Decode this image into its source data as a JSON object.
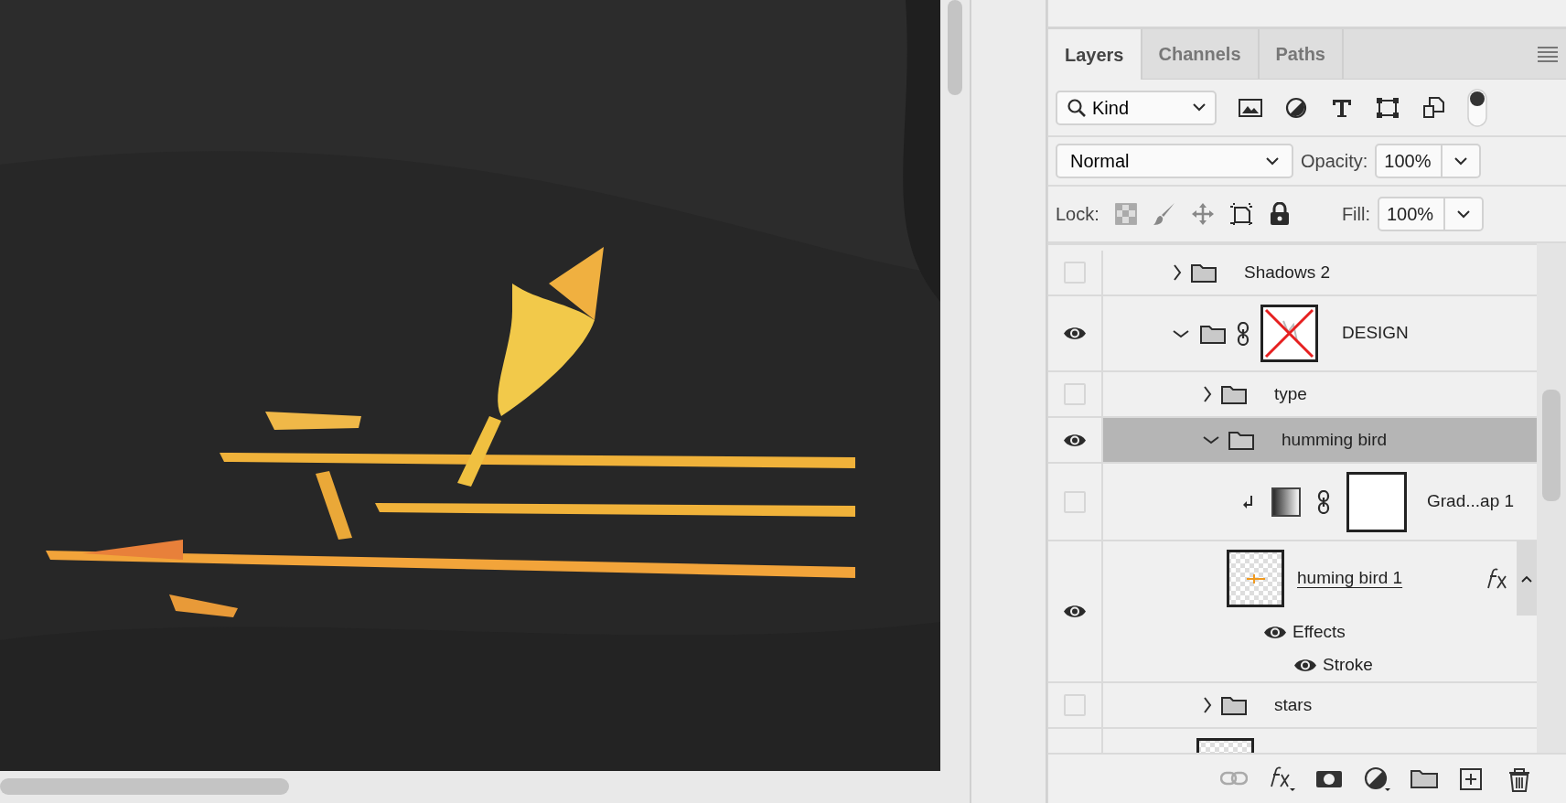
{
  "tabs": [
    {
      "label": "Layers",
      "selected": true
    },
    {
      "label": "Channels",
      "selected": false
    },
    {
      "label": "Paths",
      "selected": false
    }
  ],
  "filter": {
    "value": "Kind",
    "on": true
  },
  "blend_mode": "Normal",
  "opacity": {
    "label": "Opacity:",
    "value": "100%"
  },
  "lock": {
    "label": "Lock:"
  },
  "fill": {
    "label": "Fill:",
    "value": "100%"
  },
  "layers": [
    {
      "kind": "group",
      "name": "Shadows 2",
      "visible": false,
      "expanded": false,
      "selected": false
    },
    {
      "kind": "group",
      "name": "DESIGN",
      "visible": true,
      "expanded": true,
      "selected": false,
      "mask_disabled": true,
      "children": [
        {
          "kind": "group",
          "name": "type",
          "visible": false,
          "expanded": false,
          "selected": false
        },
        {
          "kind": "group",
          "name": "humming bird",
          "visible": true,
          "expanded": true,
          "selected": true,
          "children": [
            {
              "kind": "adjustment",
              "name": "Grad...ap 1",
              "visible": false,
              "clipped": true,
              "selected": false
            },
            {
              "kind": "pixel",
              "name": "huming bird 1",
              "visible": true,
              "selected": false,
              "effects_expanded": true,
              "effects": [
                {
                  "name": "Effects",
                  "visible": true
                },
                {
                  "name": "Stroke",
                  "visible": true
                }
              ]
            }
          ]
        },
        {
          "kind": "group",
          "name": "stars",
          "visible": false,
          "expanded": false,
          "selected": false
        },
        {
          "kind": "pixel",
          "selected": false
        }
      ]
    }
  ]
}
